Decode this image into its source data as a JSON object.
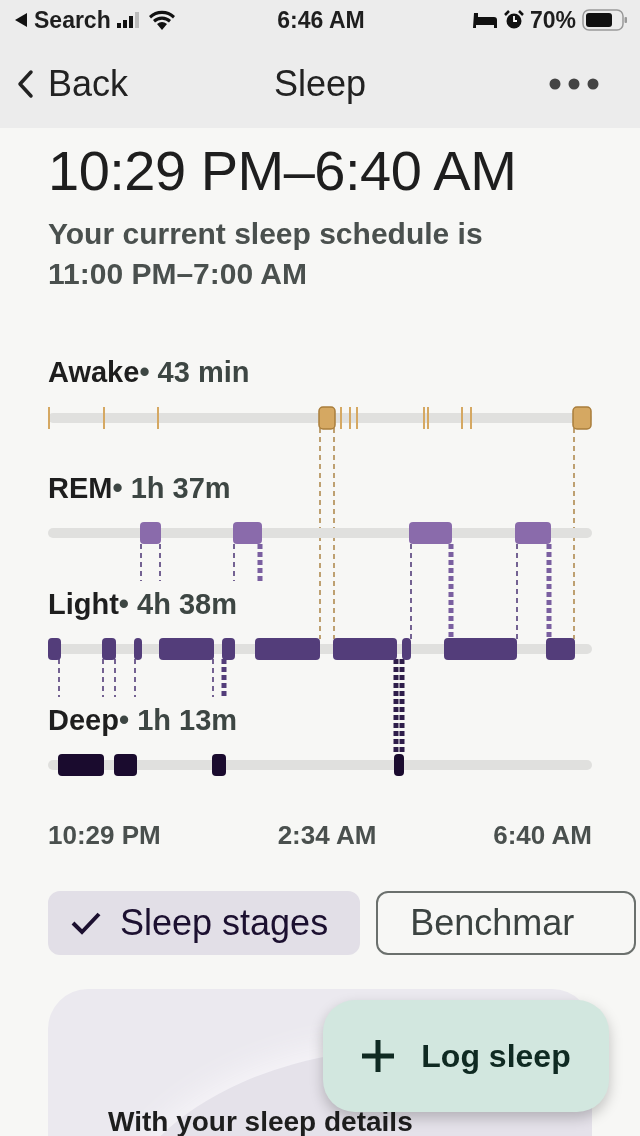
{
  "status_bar": {
    "back_app": "Search",
    "time": "6:46 AM",
    "battery": "70%"
  },
  "nav": {
    "back": "Back",
    "title": "Sleep"
  },
  "summary": {
    "time_range": "10:29 PM–6:40 AM",
    "schedule": "Your current sleep schedule is 11:00 PM–7:00 AM"
  },
  "stages": [
    {
      "kind": "awake",
      "name": "Awake",
      "duration": "• 43 min"
    },
    {
      "kind": "rem",
      "name": "REM",
      "duration": "• 1h 37m"
    },
    {
      "kind": "light",
      "name": "Light",
      "duration": "• 4h 38m"
    },
    {
      "kind": "deep",
      "name": "Deep",
      "duration": "• 1h 13m"
    }
  ],
  "axis_labels": [
    "10:29 PM",
    "2:34 AM",
    "6:40 AM"
  ],
  "chips": [
    {
      "label": "Sleep stages",
      "selected": true
    },
    {
      "label": "Benchmar",
      "selected": false
    }
  ],
  "fab": {
    "label": "Log sleep"
  },
  "card": {
    "text": "With your sleep details"
  }
}
